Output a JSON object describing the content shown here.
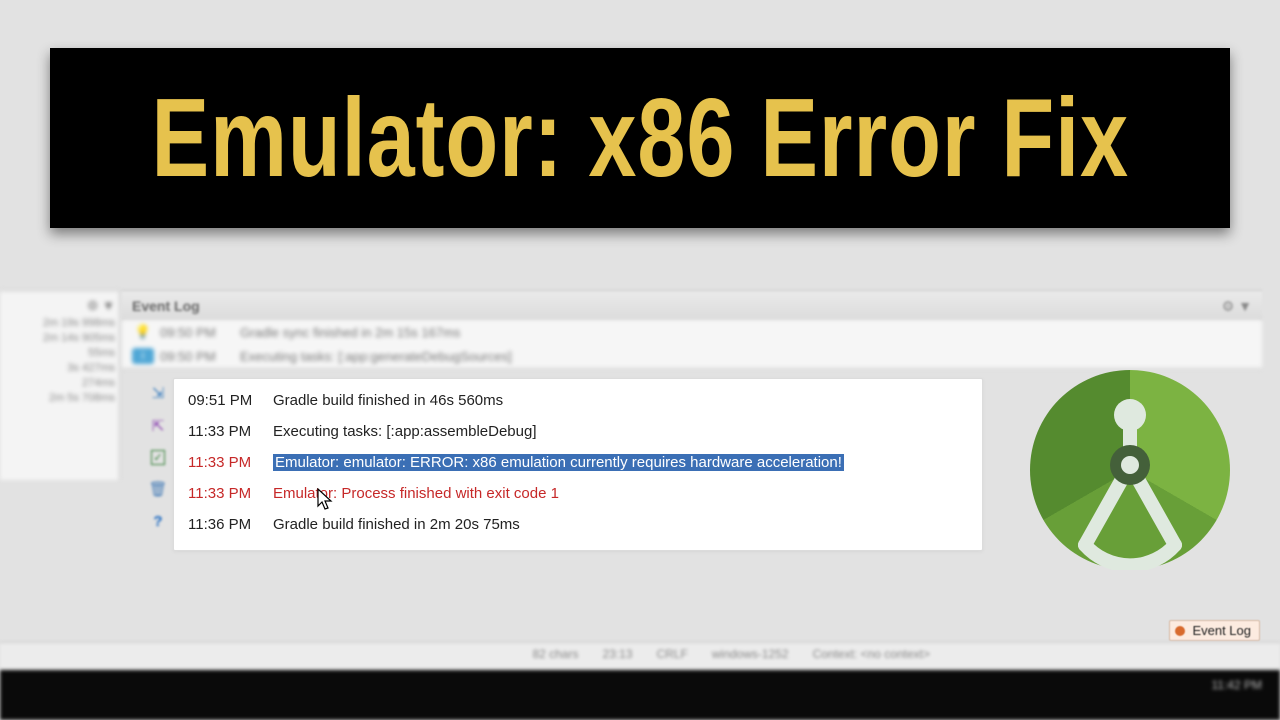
{
  "banner": {
    "title": "Emulator: x86 Error Fix"
  },
  "left_panel": {
    "entries": [
      "2m 19s 998ms",
      "2m 14s 905ms",
      "55ms",
      "3s 427ms",
      "274ms",
      "2m 5s 708ms"
    ]
  },
  "event_log": {
    "header": "Event Log",
    "blurred_rows": [
      {
        "icon": "bulb",
        "time": "09:50 PM",
        "msg": "Gradle sync finished in 2m 15s 167ms"
      },
      {
        "icon": "info",
        "time": "09:50 PM",
        "msg": "Executing tasks: [:app:generateDebugSources]"
      }
    ],
    "rows": [
      {
        "time": "09:51 PM",
        "msg": "Gradle build finished in 46s 560ms",
        "kind": "normal"
      },
      {
        "time": "11:33 PM",
        "msg": "Executing tasks: [:app:assembleDebug]",
        "kind": "normal"
      },
      {
        "time": "11:33 PM",
        "msg": "Emulator: emulator: ERROR: x86 emulation currently requires hardware acceleration!",
        "kind": "error-selected"
      },
      {
        "time": "11:33 PM",
        "msg": "Emulator: Process finished with exit code 1",
        "kind": "error"
      },
      {
        "time": "11:36 PM",
        "msg": "Gradle build finished in 2m 20s 75ms",
        "kind": "normal"
      }
    ]
  },
  "status_bar": {
    "chars": "82 chars",
    "pos": "23:13",
    "crlf": "CRLF",
    "encoding": "windows-1252",
    "context": "Context:  <no context>",
    "event_log_btn": "Event Log"
  },
  "taskbar": {
    "time": "11:42 PM",
    "date": ""
  }
}
